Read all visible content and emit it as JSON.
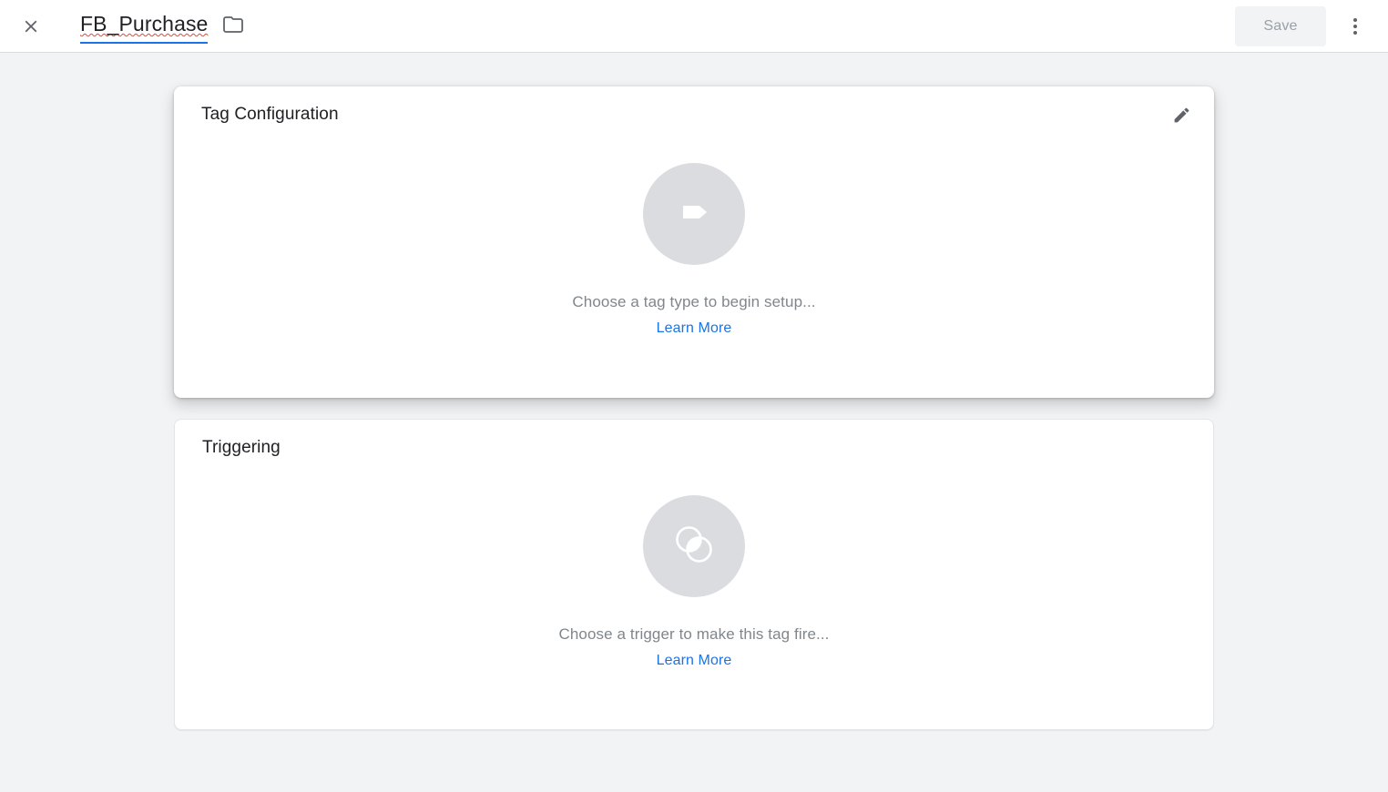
{
  "header": {
    "close_label": "close-icon",
    "tag_name": "FB_Purchase",
    "folder_label": "folder-icon",
    "save_label": "Save",
    "more_label": "more-options-icon"
  },
  "cards": [
    {
      "title": "Tag Configuration",
      "icon": "tag-icon",
      "has_edit": true,
      "edit_label": "edit-icon",
      "placeholder_text": "Choose a tag type to begin setup...",
      "learn_more_label": "Learn More"
    },
    {
      "title": "Triggering",
      "icon": "trigger-icon",
      "has_edit": false,
      "placeholder_text": "Choose a trigger to make this tag fire...",
      "learn_more_label": "Learn More"
    }
  ],
  "colors": {
    "link": "#1a73e8",
    "page_background": "#f1f3f4",
    "card_background": "#ffffff",
    "placeholder_circle": "#dadce0",
    "placeholder_text": "#80868b",
    "spellcheck_underline": "#ea4335",
    "icon_gray": "#5f6368",
    "save_disabled_text": "#9aa0a6"
  }
}
